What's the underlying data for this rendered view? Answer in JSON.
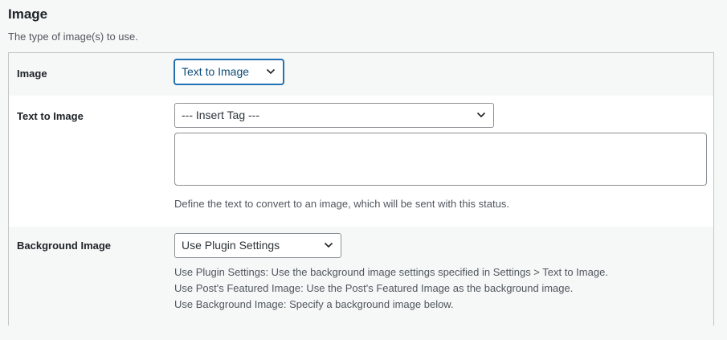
{
  "section": {
    "title": "Image",
    "description": "The type of image(s) to use."
  },
  "fields": {
    "image": {
      "label": "Image",
      "selected": "Text to Image"
    },
    "text_to_image": {
      "label": "Text to Image",
      "tag_select": "--- Insert Tag ---",
      "textarea_value": "",
      "help": "Define the text to convert to an image, which will be sent with this status."
    },
    "background_image": {
      "label": "Background Image",
      "selected": "Use Plugin Settings",
      "help_lines": [
        "Use Plugin Settings: Use the background image settings specified in Settings > Text to Image.",
        "Use Post's Featured Image: Use the Post's Featured Image as the background image.",
        "Use Background Image: Specify a background image below."
      ]
    }
  },
  "icons": {
    "dropdown": "chevron-down-icon"
  },
  "colors": {
    "focus": "#2271b1",
    "border": "#8c8f94",
    "alt_row": "#f6f7f7"
  }
}
